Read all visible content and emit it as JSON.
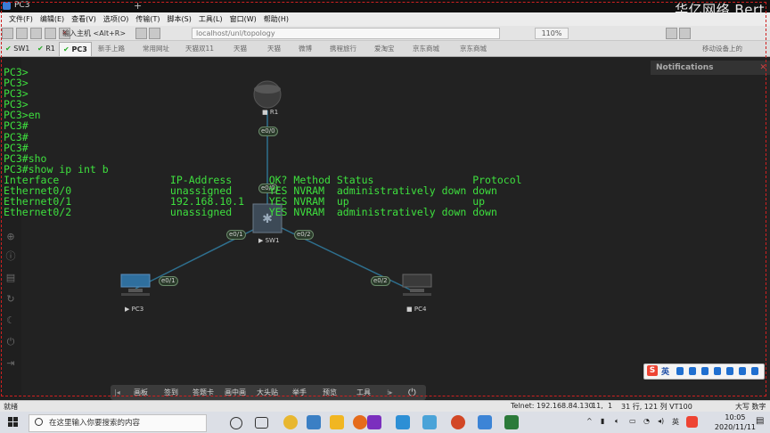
{
  "window": {
    "title": "PC3",
    "watermark": "华亿网络 Bert"
  },
  "menu": [
    "文件(F)",
    "编辑(E)",
    "查看(V)",
    "选项(O)",
    "传输(T)",
    "脚本(S)",
    "工具(L)",
    "窗口(W)",
    "帮助(H)"
  ],
  "toolbar": {
    "host_placeholder": "输入主机 <Alt+R>",
    "zoom": "110%"
  },
  "tabs": [
    "SW1",
    "R1",
    "PC3"
  ],
  "bookmarks": [
    "新手上路",
    "常用网址",
    "天猫双11",
    "天猫",
    "天猫",
    "微博",
    "携程旅行",
    "爱淘宝",
    "京东商城",
    "京东商城"
  ],
  "bookmarks_right": "移动设备上的",
  "notifications": {
    "title": "Notifications"
  },
  "terminal_lines": [
    "PC3>",
    "PC3>",
    "PC3>",
    "PC3>",
    "PC3>en",
    "PC3#",
    "PC3#",
    "PC3#",
    "PC3#sho",
    "PC3#show ip int b",
    "Interface                  IP-Address      OK? Method Status                Protocol",
    "Ethernet0/0                unassigned      YES NVRAM  administratively down down",
    "Ethernet0/1                192.168.10.1    YES NVRAM  up                    up",
    "Ethernet0/2                unassigned      YES NVRAM  administratively down down"
  ],
  "topology": {
    "r1": {
      "label": "R1"
    },
    "sw1": {
      "label": "SW1"
    },
    "pc3": {
      "label": "PC3"
    },
    "pc4": {
      "label": "PC4"
    },
    "ports": {
      "r1_e00": "e0/0",
      "sw_e00": "e0/0",
      "sw_e01": "e0/1",
      "sw_e02": "e0/2",
      "pc3_e01": "e0/1",
      "pc4_e02": "e0/2"
    }
  },
  "palette": [
    "画板",
    "签到",
    "答题卡",
    "画中画",
    "大头贴",
    "举手",
    "预览",
    "工具"
  ],
  "ime": {
    "lang": "英"
  },
  "status": {
    "left": "就绪",
    "telnet": "Telnet: 192.168.84.130",
    "row": "11,",
    "col": "1",
    "size": "31 行, 121 列 VT100",
    "caps": "大写 数字"
  },
  "taskbar": {
    "search_placeholder": "在这里输入你要搜索的内容",
    "ime": "英",
    "time": "10:05",
    "date": "2020/11/11"
  },
  "colors": {
    "terminal_text": "#3ee03e",
    "canvas_bg": "#222222",
    "link_line": "#2e6f8e"
  }
}
